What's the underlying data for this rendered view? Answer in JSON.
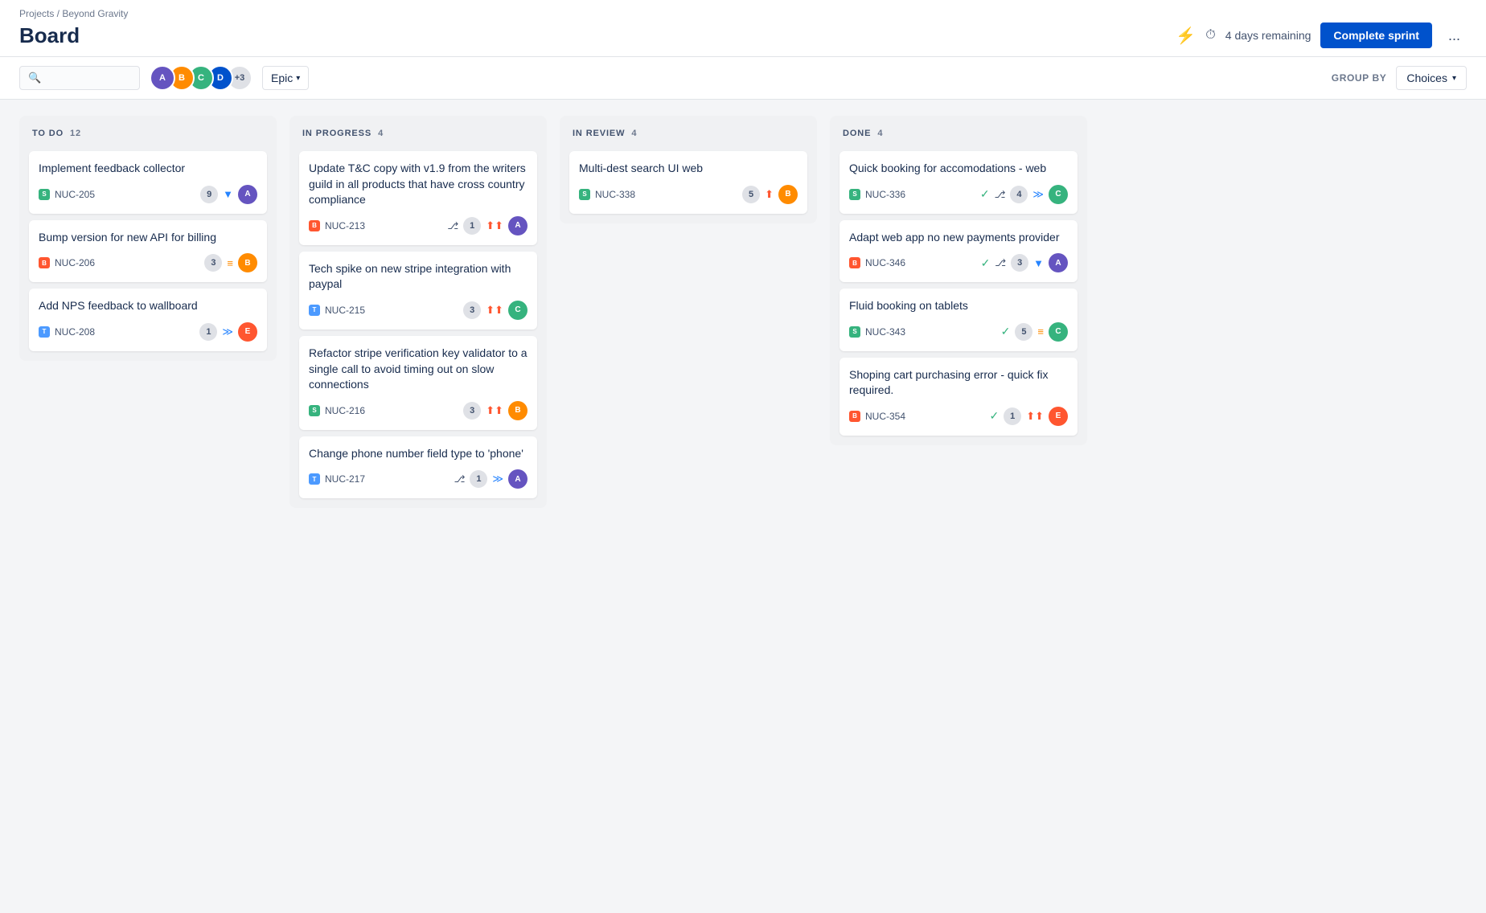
{
  "breadcrumb": "Projects / Beyond Gravity",
  "page_title": "Board",
  "search": {
    "placeholder": ""
  },
  "sprint_info": {
    "days": "4 days remaining"
  },
  "complete_sprint_btn": "Complete sprint",
  "group_by_label": "GROUP BY",
  "choices_label": "Choices",
  "epic_label": "Epic",
  "more_label": "...",
  "avatars": [
    {
      "id": "av1",
      "color": "#6554c0",
      "initials": "A"
    },
    {
      "id": "av2",
      "color": "#ff8b00",
      "initials": "B"
    },
    {
      "id": "av3",
      "color": "#36b37e",
      "initials": "C"
    },
    {
      "id": "av4",
      "color": "#0052cc",
      "initials": "D"
    },
    {
      "id": "av5",
      "color": "+3"
    }
  ],
  "columns": [
    {
      "id": "todo",
      "name": "TO DO",
      "count": 12,
      "cards": [
        {
          "id": "c1",
          "title": "Implement feedback collector",
          "issue_type": "story",
          "issue_id": "NUC-205",
          "count": 9,
          "priority": "low",
          "priority_symbol": "▼",
          "avatar_color": "#6554c0",
          "avatar_initials": "A"
        },
        {
          "id": "c2",
          "title": "Bump version for new API for billing",
          "issue_type": "bug",
          "issue_id": "NUC-206",
          "count": 3,
          "priority": "medium",
          "priority_symbol": "═",
          "avatar_color": "#ff8b00",
          "avatar_initials": "B"
        },
        {
          "id": "c3",
          "title": "Add NPS feedback to wallboard",
          "issue_type": "task",
          "issue_id": "NUC-208",
          "count": 1,
          "priority": "low",
          "priority_symbol": "≫",
          "avatar_color": "#ff5630",
          "avatar_initials": "E"
        }
      ]
    },
    {
      "id": "inprogress",
      "name": "IN PROGRESS",
      "count": 4,
      "cards": [
        {
          "id": "c4",
          "title": "Update T&C copy with v1.9 from the writers guild in all products that have cross country compliance",
          "issue_type": "bug",
          "issue_id": "NUC-213",
          "count": 1,
          "priority": "high",
          "priority_symbol": "⋀⋀",
          "avatar_color": "#6554c0",
          "avatar_initials": "A",
          "show_branch": true
        },
        {
          "id": "c5",
          "title": "Tech spike on new stripe integration with paypal",
          "issue_type": "task",
          "issue_id": "NUC-215",
          "count": 3,
          "priority": "high",
          "priority_symbol": "⋀⋀",
          "avatar_color": "#36b37e",
          "avatar_initials": "C"
        },
        {
          "id": "c6",
          "title": "Refactor stripe verification key validator to a single call to avoid timing out on slow connections",
          "issue_type": "story",
          "issue_id": "NUC-216",
          "count": 3,
          "priority": "high",
          "priority_symbol": "⋀⋀",
          "avatar_color": "#ff8b00",
          "avatar_initials": "B"
        },
        {
          "id": "c7",
          "title": "Change phone number field type to 'phone'",
          "issue_type": "task",
          "issue_id": "NUC-217",
          "count": 1,
          "priority": "low",
          "priority_symbol": "≫",
          "avatar_color": "#6554c0",
          "avatar_initials": "A",
          "show_branch": true
        }
      ]
    },
    {
      "id": "inreview",
      "name": "IN REVIEW",
      "count": 4,
      "cards": [
        {
          "id": "c8",
          "title": "Multi-dest search UI web",
          "issue_type": "story",
          "issue_id": "NUC-338",
          "count": 5,
          "priority": "high",
          "priority_symbol": "⋀",
          "avatar_color": "#ff8b00",
          "avatar_initials": "B"
        }
      ]
    },
    {
      "id": "done",
      "name": "DONE",
      "count": 4,
      "cards": [
        {
          "id": "c9",
          "title": "Quick booking for accomodations - web",
          "issue_type": "story",
          "issue_id": "NUC-336",
          "count": 4,
          "priority": "low",
          "priority_symbol": "≫",
          "avatar_color": "#36b37e",
          "avatar_initials": "C",
          "show_check": true,
          "show_branch": true
        },
        {
          "id": "c10",
          "title": "Adapt web app no new payments provider",
          "issue_type": "bug",
          "issue_id": "NUC-346",
          "count": 3,
          "priority": "low",
          "priority_symbol": "▼",
          "avatar_color": "#6554c0",
          "avatar_initials": "A",
          "show_check": true,
          "show_branch": true
        },
        {
          "id": "c11",
          "title": "Fluid booking on tablets",
          "issue_type": "story",
          "issue_id": "NUC-343",
          "count": 5,
          "priority": "medium",
          "priority_symbol": "═",
          "avatar_color": "#36b37e",
          "avatar_initials": "C",
          "show_check": true
        },
        {
          "id": "c12",
          "title": "Shoping cart purchasing error - quick fix required.",
          "issue_type": "bug",
          "issue_id": "NUC-354",
          "count": 1,
          "priority": "critical",
          "priority_symbol": "⋀⋀",
          "avatar_color": "#ff5630",
          "avatar_initials": "E",
          "show_check": true
        }
      ]
    }
  ]
}
